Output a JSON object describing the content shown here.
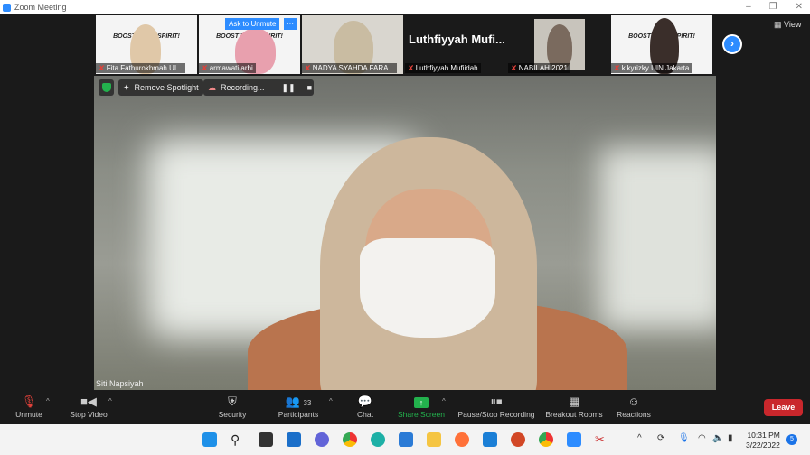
{
  "window": {
    "title": "Zoom Meeting",
    "controls": [
      "–",
      "❐",
      "✕"
    ]
  },
  "gallery": {
    "tiles": [
      {
        "name": "Fita Fathurokhmah UI...",
        "slide_text": "BOOST YOUR SPIRIT!"
      },
      {
        "name": "armawati arbi",
        "slide_text": "BOOST YOUR SPIRIT!",
        "hover_button": "Ask to Unmute",
        "more_button": "···"
      },
      {
        "name": "NADYA SYAHDA FARA..."
      },
      {
        "name": "Luthfiyyah Mufiidah",
        "big_name": "Luthfiyyah  Mufi..."
      },
      {
        "name": "NABILAH 2021"
      },
      {
        "name": "kikyrizky UIN Jakarta",
        "slide_text": "BOOST YOUR SPIRIT!"
      }
    ],
    "next_label": "›",
    "view_label": "View"
  },
  "main_video": {
    "remove_spotlight": "Remove Spotlight",
    "recording": "Recording...",
    "speaker_name": "Siti Napsiyah"
  },
  "toolbar": {
    "unmute": "Unmute",
    "stop_video": "Stop Video",
    "security": "Security",
    "participants": "Participants",
    "participants_count": "33",
    "chat": "Chat",
    "share_screen": "Share Screen",
    "recording": "Pause/Stop Recording",
    "breakout": "Breakout Rooms",
    "reactions": "Reactions",
    "leave": "Leave"
  },
  "taskbar": {
    "time": "10:31 PM",
    "date": "3/22/2022",
    "notifications": "5"
  },
  "colors": {
    "accent": "#2d8cff",
    "leave": "#c9272c",
    "share": "#23b14d"
  }
}
